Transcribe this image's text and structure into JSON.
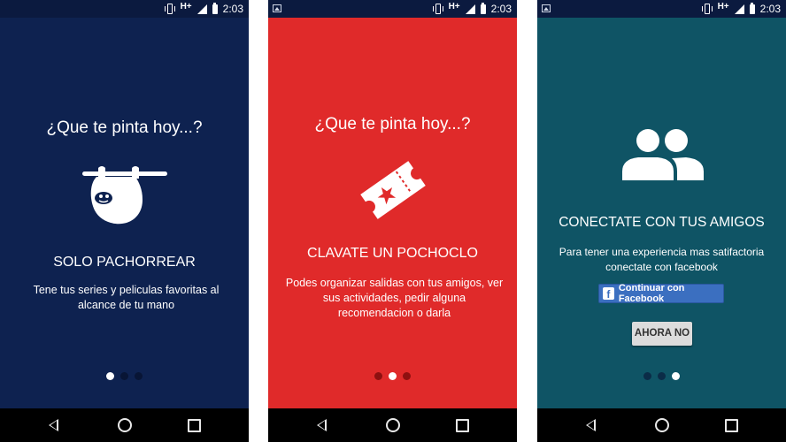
{
  "status_bar": {
    "network": "H+",
    "time": "2:03"
  },
  "screens": [
    {
      "heading": "¿Que te pinta hoy...?",
      "title": "SOLO PACHORREAR",
      "description": "Tene tus series y peliculas favoritas al alcance de tu mano",
      "icon": "sloth-icon",
      "active_dot": 0,
      "background": "#0e2250"
    },
    {
      "heading": "¿Que te pinta hoy...?",
      "title": "CLAVATE UN POCHOCLO",
      "description": "Podes organizar salidas con tus amigos, ver sus actividades, pedir alguna recomendacion o darla",
      "icon": "ticket-icon",
      "active_dot": 1,
      "background": "#e02a2a"
    },
    {
      "title": "CONECTATE CON TUS AMIGOS",
      "description": "Para tener una experiencia mas satifactoria conectate con facebook",
      "icon": "people-icon",
      "facebook_button": "Continuar con Facebook",
      "skip_button": "AHORA NO",
      "active_dot": 2,
      "background": "#0f5465"
    }
  ]
}
